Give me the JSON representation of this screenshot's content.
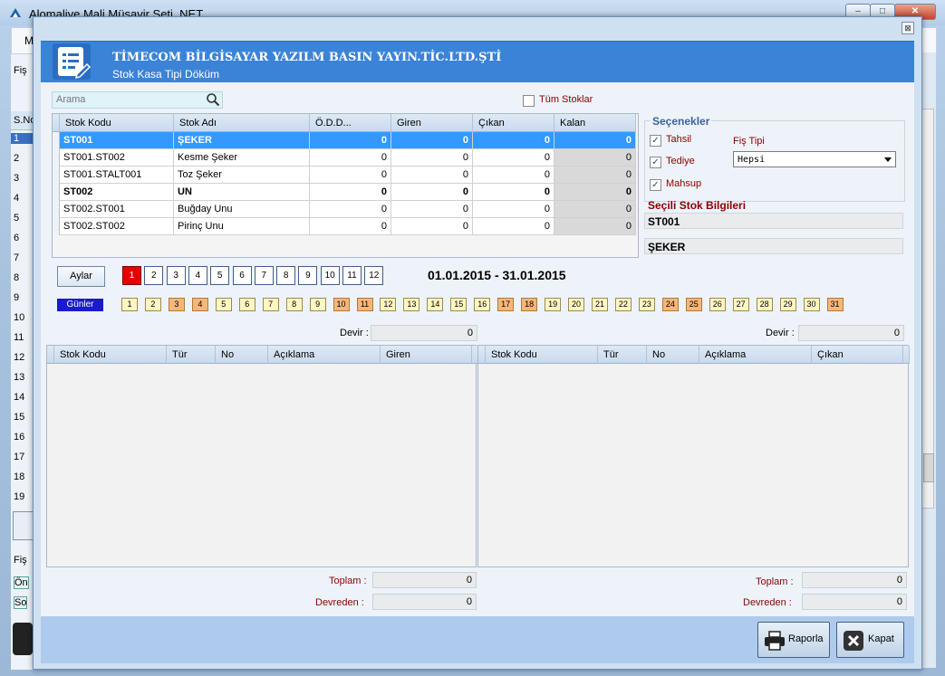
{
  "background": {
    "title": "Alomaliye Mali Müşavir Seti .NET",
    "menu_first": "M",
    "left_header": "S.No",
    "fis_label": "Fiş",
    "row_numbers": [
      "1",
      "2",
      "3",
      "4",
      "5",
      "6",
      "7",
      "8",
      "9",
      "10",
      "11",
      "12",
      "13",
      "14",
      "15",
      "16",
      "17",
      "18",
      "19"
    ],
    "bottom_items": [
      "Fiş",
      "Ön",
      "So"
    ]
  },
  "dialog": {
    "close_label": "⊠",
    "company": "TİMECOM BİLGİSAYAR YAZILM BASIN YAYIN.TİC.LTD.ŞTİ",
    "subtitle": "Stok Kasa Tipi Döküm",
    "search_placeholder": "Arama",
    "all_stocks_label": "Tüm Stoklar",
    "grid": {
      "columns": [
        "Stok Kodu",
        "Stok Adı",
        "Ö.D.D...",
        "Giren",
        "Çıkan",
        "Kalan"
      ],
      "rows": [
        {
          "kod": "ST001",
          "ad": "ŞEKER",
          "odd": "0",
          "giren": "0",
          "cikan": "0",
          "kalan": "0",
          "style": "sel"
        },
        {
          "kod": "ST001.ST002",
          "ad": "Kesme Şeker",
          "odd": "0",
          "giren": "0",
          "cikan": "0",
          "kalan": "0",
          "style": ""
        },
        {
          "kod": "ST001.STALT001",
          "ad": "Toz Şeker",
          "odd": "0",
          "giren": "0",
          "cikan": "0",
          "kalan": "0",
          "style": ""
        },
        {
          "kod": "ST002",
          "ad": "UN",
          "odd": "0",
          "giren": "0",
          "cikan": "0",
          "kalan": "0",
          "style": "bold"
        },
        {
          "kod": "ST002.ST001",
          "ad": "Buğday Unu",
          "odd": "0",
          "giren": "0",
          "cikan": "0",
          "kalan": "0",
          "style": ""
        },
        {
          "kod": "ST002.ST002",
          "ad": "Pirinç Unu",
          "odd": "0",
          "giren": "0",
          "cikan": "0",
          "kalan": "0",
          "style": ""
        }
      ]
    },
    "options": {
      "title": "Seçenekler",
      "tahsil": "Tahsil",
      "tediye": "Tediye",
      "mahsup": "Mahsup",
      "checked": [
        true,
        true,
        true
      ],
      "fis_tipi_label": "Fiş Tipi",
      "fis_tipi_value": "Hepsi"
    },
    "selected_stock": {
      "title": "Seçili Stok Bilgileri",
      "code": "ST001",
      "name": "ŞEKER"
    },
    "months_label": "Aylar",
    "months": [
      "1",
      "2",
      "3",
      "4",
      "5",
      "6",
      "7",
      "8",
      "9",
      "10",
      "11",
      "12"
    ],
    "active_month": "1",
    "date_range": "01.01.2015 - 31.01.2015",
    "days_label": "Günler",
    "days": [
      "1",
      "2",
      "3",
      "4",
      "5",
      "6",
      "7",
      "8",
      "9",
      "10",
      "11",
      "12",
      "13",
      "14",
      "15",
      "16",
      "17",
      "18",
      "19",
      "20",
      "21",
      "22",
      "23",
      "24",
      "25",
      "26",
      "27",
      "28",
      "29",
      "30",
      "31"
    ],
    "weekend_days": [
      "3",
      "4",
      "10",
      "11",
      "17",
      "18",
      "24",
      "25",
      "31"
    ],
    "left": {
      "devir_label": "Devir :",
      "devir_value": "0",
      "columns": [
        "Stok Kodu",
        "Tür",
        "No",
        "Açıklama",
        "Giren"
      ],
      "toplam_label": "Toplam :",
      "toplam_value": "0",
      "devreden_label": "Devreden :",
      "devreden_value": "0"
    },
    "right": {
      "devir_label": "Devir :",
      "devir_value": "0",
      "columns": [
        "Stok Kodu",
        "Tür",
        "No",
        "Açıklama",
        "Çıkan"
      ],
      "toplam_label": "Toplam :",
      "toplam_value": "0",
      "devreden_label": "Devreden :",
      "devreden_value": "0"
    },
    "buttons": {
      "raporla": "Raporla",
      "kapat": "Kapat"
    },
    "colors": {
      "header_blue": "#3b83d6",
      "selected_row": "#3399ff",
      "active_month": "#e60000",
      "weekend_day": "#f7b679",
      "weekday": "#fff7c2",
      "label_red": "#8b0000"
    }
  }
}
